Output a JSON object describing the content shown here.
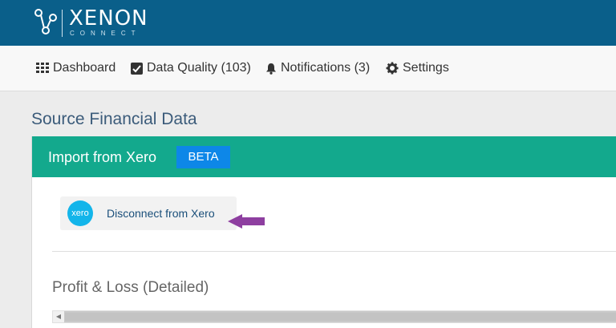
{
  "brand": {
    "name": "XENON",
    "tagline": "CONNECT"
  },
  "nav": {
    "items": [
      {
        "label": "Dashboard",
        "icon": "grid-icon"
      },
      {
        "label": "Data Quality (103)",
        "icon": "checkbox-icon"
      },
      {
        "label": "Notifications (3)",
        "icon": "bell-icon"
      },
      {
        "label": "Settings",
        "icon": "gear-icon"
      }
    ]
  },
  "page": {
    "title": "Source Financial Data"
  },
  "card": {
    "header_title": "Import from Xero",
    "badge": "BETA",
    "xero_logo_text": "xero",
    "disconnect_label": "Disconnect from Xero",
    "section_title": "Profit & Loss (Detailed)"
  },
  "colors": {
    "topbar": "#0a5f8a",
    "card_header": "#13a98d",
    "beta_badge": "#0d87e8",
    "xero_blue": "#13b5ea",
    "arrow": "#8e3fa0"
  }
}
